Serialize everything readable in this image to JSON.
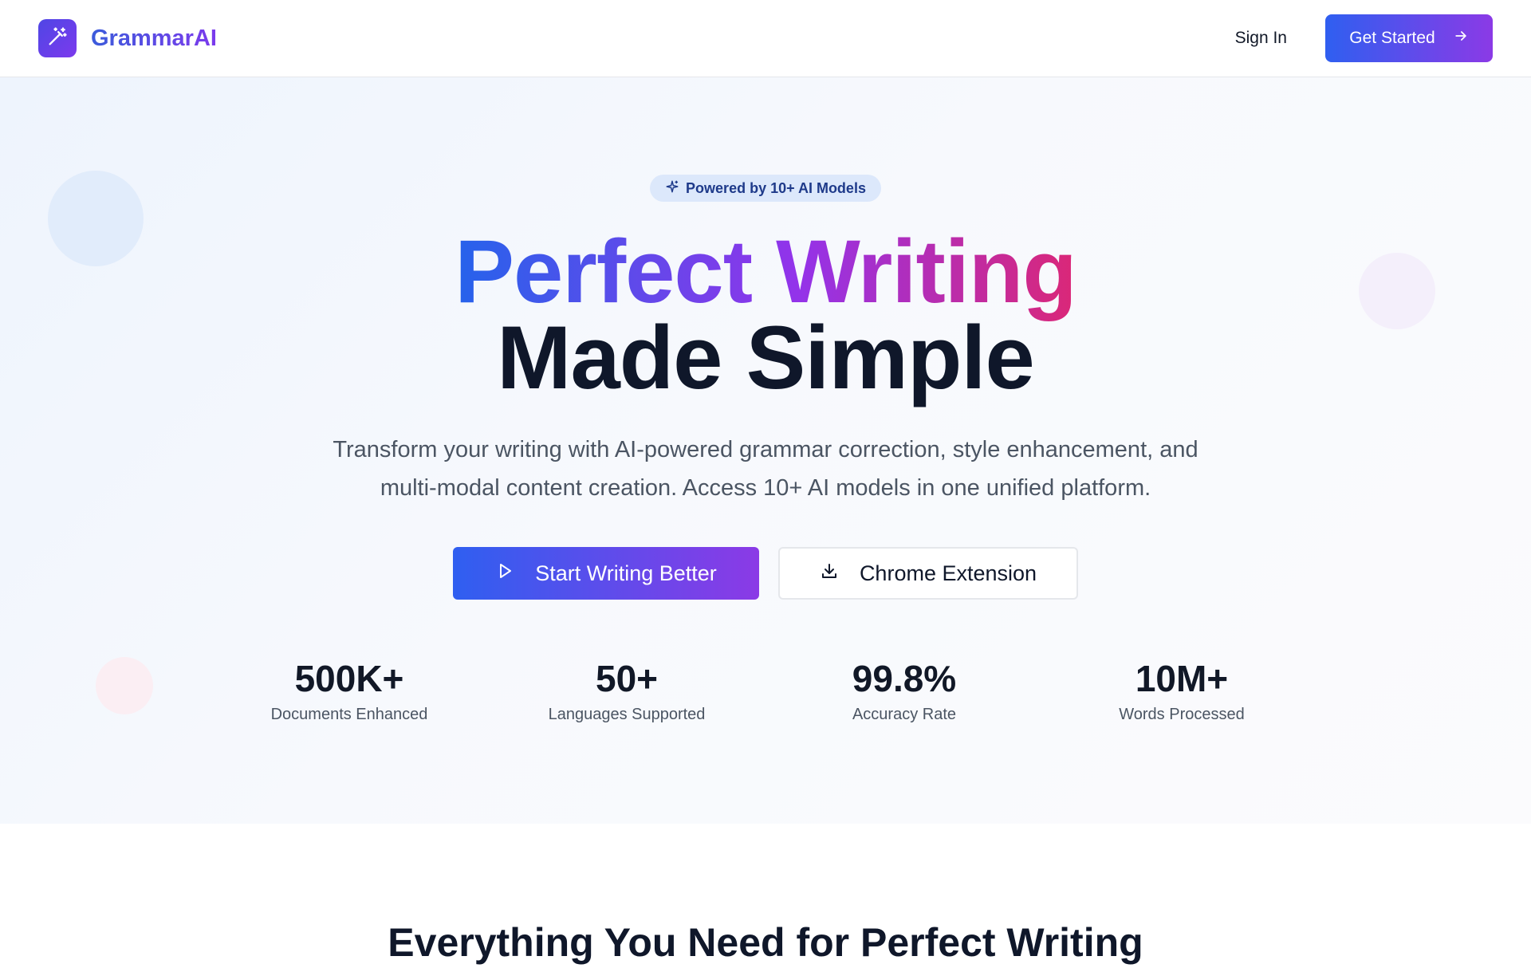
{
  "nav": {
    "brand_name": "GrammarAI",
    "signin_label": "Sign In",
    "get_started_label": "Get Started"
  },
  "hero": {
    "badge_text": "Powered by 10+ AI Models",
    "headline_line1": "Perfect Writing",
    "headline_line2": "Made Simple",
    "subtitle_line1": "Transform your writing with AI-powered grammar correction, style enhancement, and",
    "subtitle_line2": "multi-modal content creation. Access 10+ AI models in one unified platform.",
    "primary_cta": "Start Writing Better",
    "secondary_cta": "Chrome Extension"
  },
  "stats": [
    {
      "value": "500K+",
      "label": "Documents Enhanced"
    },
    {
      "value": "50+",
      "label": "Languages Supported"
    },
    {
      "value": "99.8%",
      "label": "Accuracy Rate"
    },
    {
      "value": "10M+",
      "label": "Words Processed"
    }
  ],
  "features": {
    "title": "Everything You Need for Perfect Writing"
  },
  "colors": {
    "primary_gradient_start": "#2f5ff0",
    "primary_gradient_end": "#8b3ae6",
    "headline_gradient_pink": "#db2777",
    "text_dark": "#0f172a"
  },
  "icons": {
    "logo": "magic-wand-icon",
    "badge": "sparkle-icon",
    "get_started": "arrow-right-icon",
    "primary_cta": "play-icon",
    "secondary_cta": "download-icon"
  }
}
